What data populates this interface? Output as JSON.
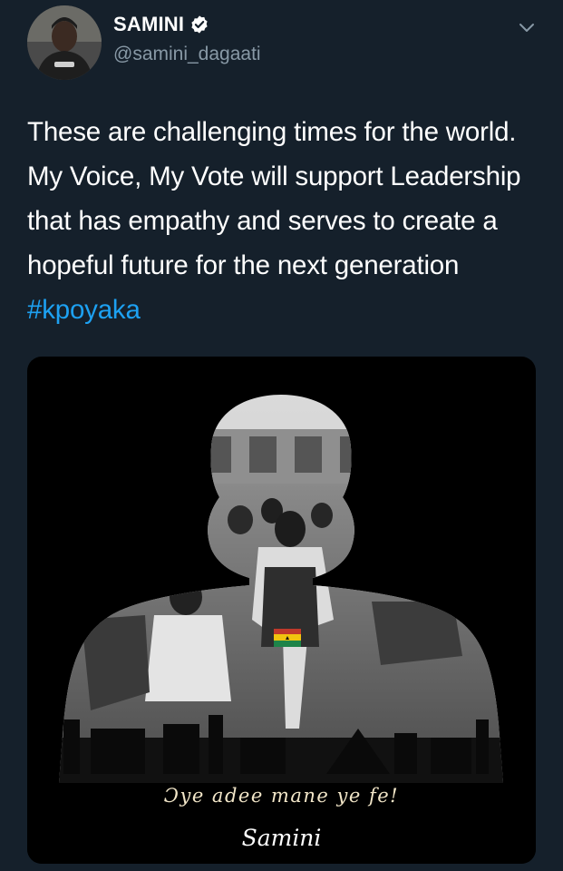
{
  "author": {
    "display_name": "SAMINI",
    "handle": "@samini_dagaati",
    "verified": true,
    "avatar_icon": "profile-photo"
  },
  "tweet": {
    "text_main": "These are challenging times for the world. My Voice, My Vote will support Leadership that has empathy and serves to create a hopeful future for the next generation ",
    "hashtag": "#kpoyaka",
    "hashtag_color": "#1da1f2"
  },
  "media": {
    "motto": "Ɔye adee mane ye fe!",
    "signature": "Samini"
  },
  "colors": {
    "background": "#15202b",
    "handle": "#8899a6",
    "accent": "#1da1f2"
  },
  "icons": {
    "menu": "chevron-down-icon",
    "verified": "verified-badge-icon"
  }
}
